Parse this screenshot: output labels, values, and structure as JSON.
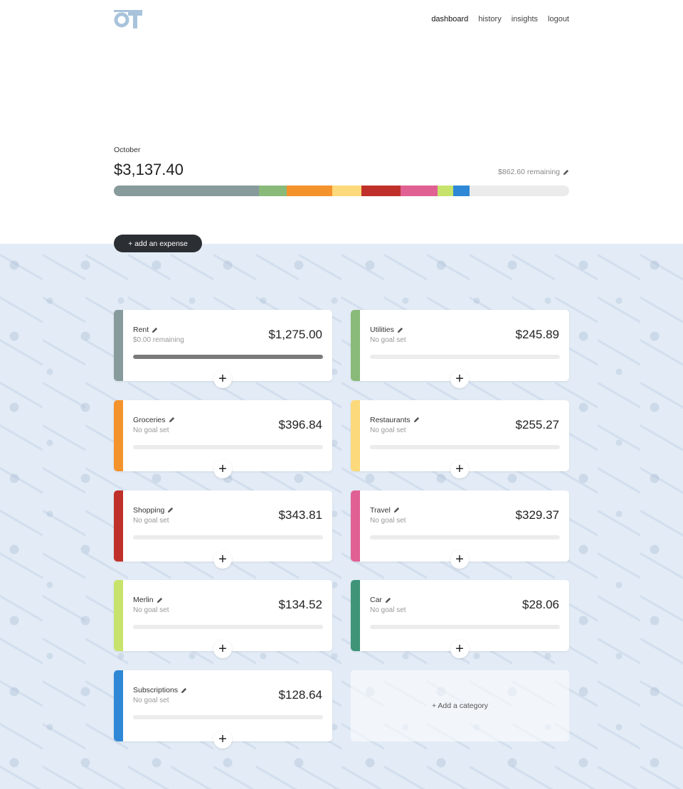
{
  "nav": {
    "items": [
      "dashboard",
      "history",
      "insights",
      "logout"
    ],
    "active": "dashboard"
  },
  "summary": {
    "month": "October",
    "total": "$3,137.40",
    "remaining": "$862.60 remaining"
  },
  "budget_bar": {
    "segments": [
      {
        "category": "Rent",
        "fraction": 0.319,
        "color": "#879a9c"
      },
      {
        "category": "Utilities",
        "fraction": 0.061,
        "color": "#8aba7a"
      },
      {
        "category": "Groceries",
        "fraction": 0.099,
        "color": "#f4922c"
      },
      {
        "category": "Restaurants",
        "fraction": 0.064,
        "color": "#fcd97a"
      },
      {
        "category": "Shopping",
        "fraction": 0.086,
        "color": "#c0302a"
      },
      {
        "category": "Travel",
        "fraction": 0.082,
        "color": "#e06094"
      },
      {
        "category": "Merlin",
        "fraction": 0.034,
        "color": "#c7e36c"
      },
      {
        "category": "Subscriptions",
        "fraction": 0.037,
        "color": "#2e88d6"
      }
    ]
  },
  "actions": {
    "add_expense": "+ add an expense",
    "add_category": "+ Add a category"
  },
  "categories": [
    {
      "name": "Rent",
      "goal": "$0.00 remaining",
      "amount": "$1,275.00",
      "color": "#879a9c",
      "progress": 1.0
    },
    {
      "name": "Utilities",
      "goal": "No goal set",
      "amount": "$245.89",
      "color": "#8aba7a",
      "progress": 0
    },
    {
      "name": "Groceries",
      "goal": "No goal set",
      "amount": "$396.84",
      "color": "#f4922c",
      "progress": 0
    },
    {
      "name": "Restaurants",
      "goal": "No goal set",
      "amount": "$255.27",
      "color": "#fcd97a",
      "progress": 0
    },
    {
      "name": "Shopping",
      "goal": "No goal set",
      "amount": "$343.81",
      "color": "#c0302a",
      "progress": 0
    },
    {
      "name": "Travel",
      "goal": "No goal set",
      "amount": "$329.37",
      "color": "#e06094",
      "progress": 0
    },
    {
      "name": "Merlin",
      "goal": "No goal set",
      "amount": "$134.52",
      "color": "#c7e36c",
      "progress": 0
    },
    {
      "name": "Car",
      "goal": "No goal set",
      "amount": "$28.06",
      "color": "#3d9477",
      "progress": 0
    },
    {
      "name": "Subscriptions",
      "goal": "No goal set",
      "amount": "$128.64",
      "color": "#2e88d6",
      "progress": 0
    }
  ]
}
